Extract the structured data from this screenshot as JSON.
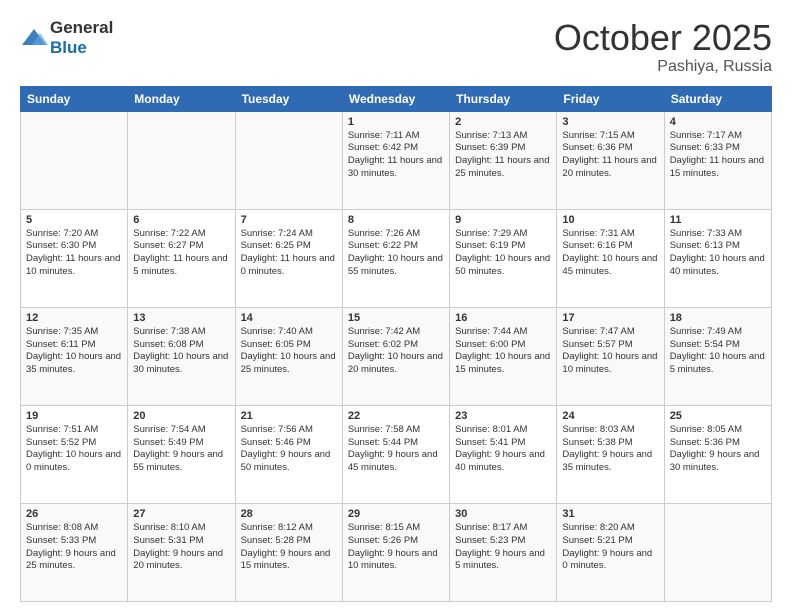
{
  "header": {
    "logo_general": "General",
    "logo_blue": "Blue",
    "month": "October 2025",
    "location": "Pashiya, Russia"
  },
  "weekdays": [
    "Sunday",
    "Monday",
    "Tuesday",
    "Wednesday",
    "Thursday",
    "Friday",
    "Saturday"
  ],
  "weeks": [
    [
      {
        "day": "",
        "info": ""
      },
      {
        "day": "",
        "info": ""
      },
      {
        "day": "",
        "info": ""
      },
      {
        "day": "1",
        "info": "Sunrise: 7:11 AM\nSunset: 6:42 PM\nDaylight: 11 hours\nand 30 minutes."
      },
      {
        "day": "2",
        "info": "Sunrise: 7:13 AM\nSunset: 6:39 PM\nDaylight: 11 hours\nand 25 minutes."
      },
      {
        "day": "3",
        "info": "Sunrise: 7:15 AM\nSunset: 6:36 PM\nDaylight: 11 hours\nand 20 minutes."
      },
      {
        "day": "4",
        "info": "Sunrise: 7:17 AM\nSunset: 6:33 PM\nDaylight: 11 hours\nand 15 minutes."
      }
    ],
    [
      {
        "day": "5",
        "info": "Sunrise: 7:20 AM\nSunset: 6:30 PM\nDaylight: 11 hours\nand 10 minutes."
      },
      {
        "day": "6",
        "info": "Sunrise: 7:22 AM\nSunset: 6:27 PM\nDaylight: 11 hours\nand 5 minutes."
      },
      {
        "day": "7",
        "info": "Sunrise: 7:24 AM\nSunset: 6:25 PM\nDaylight: 11 hours\nand 0 minutes."
      },
      {
        "day": "8",
        "info": "Sunrise: 7:26 AM\nSunset: 6:22 PM\nDaylight: 10 hours\nand 55 minutes."
      },
      {
        "day": "9",
        "info": "Sunrise: 7:29 AM\nSunset: 6:19 PM\nDaylight: 10 hours\nand 50 minutes."
      },
      {
        "day": "10",
        "info": "Sunrise: 7:31 AM\nSunset: 6:16 PM\nDaylight: 10 hours\nand 45 minutes."
      },
      {
        "day": "11",
        "info": "Sunrise: 7:33 AM\nSunset: 6:13 PM\nDaylight: 10 hours\nand 40 minutes."
      }
    ],
    [
      {
        "day": "12",
        "info": "Sunrise: 7:35 AM\nSunset: 6:11 PM\nDaylight: 10 hours\nand 35 minutes."
      },
      {
        "day": "13",
        "info": "Sunrise: 7:38 AM\nSunset: 6:08 PM\nDaylight: 10 hours\nand 30 minutes."
      },
      {
        "day": "14",
        "info": "Sunrise: 7:40 AM\nSunset: 6:05 PM\nDaylight: 10 hours\nand 25 minutes."
      },
      {
        "day": "15",
        "info": "Sunrise: 7:42 AM\nSunset: 6:02 PM\nDaylight: 10 hours\nand 20 minutes."
      },
      {
        "day": "16",
        "info": "Sunrise: 7:44 AM\nSunset: 6:00 PM\nDaylight: 10 hours\nand 15 minutes."
      },
      {
        "day": "17",
        "info": "Sunrise: 7:47 AM\nSunset: 5:57 PM\nDaylight: 10 hours\nand 10 minutes."
      },
      {
        "day": "18",
        "info": "Sunrise: 7:49 AM\nSunset: 5:54 PM\nDaylight: 10 hours\nand 5 minutes."
      }
    ],
    [
      {
        "day": "19",
        "info": "Sunrise: 7:51 AM\nSunset: 5:52 PM\nDaylight: 10 hours\nand 0 minutes."
      },
      {
        "day": "20",
        "info": "Sunrise: 7:54 AM\nSunset: 5:49 PM\nDaylight: 9 hours\nand 55 minutes."
      },
      {
        "day": "21",
        "info": "Sunrise: 7:56 AM\nSunset: 5:46 PM\nDaylight: 9 hours\nand 50 minutes."
      },
      {
        "day": "22",
        "info": "Sunrise: 7:58 AM\nSunset: 5:44 PM\nDaylight: 9 hours\nand 45 minutes."
      },
      {
        "day": "23",
        "info": "Sunrise: 8:01 AM\nSunset: 5:41 PM\nDaylight: 9 hours\nand 40 minutes."
      },
      {
        "day": "24",
        "info": "Sunrise: 8:03 AM\nSunset: 5:38 PM\nDaylight: 9 hours\nand 35 minutes."
      },
      {
        "day": "25",
        "info": "Sunrise: 8:05 AM\nSunset: 5:36 PM\nDaylight: 9 hours\nand 30 minutes."
      }
    ],
    [
      {
        "day": "26",
        "info": "Sunrise: 8:08 AM\nSunset: 5:33 PM\nDaylight: 9 hours\nand 25 minutes."
      },
      {
        "day": "27",
        "info": "Sunrise: 8:10 AM\nSunset: 5:31 PM\nDaylight: 9 hours\nand 20 minutes."
      },
      {
        "day": "28",
        "info": "Sunrise: 8:12 AM\nSunset: 5:28 PM\nDaylight: 9 hours\nand 15 minutes."
      },
      {
        "day": "29",
        "info": "Sunrise: 8:15 AM\nSunset: 5:26 PM\nDaylight: 9 hours\nand 10 minutes."
      },
      {
        "day": "30",
        "info": "Sunrise: 8:17 AM\nSunset: 5:23 PM\nDaylight: 9 hours\nand 5 minutes."
      },
      {
        "day": "31",
        "info": "Sunrise: 8:20 AM\nSunset: 5:21 PM\nDaylight: 9 hours\nand 0 minutes."
      },
      {
        "day": "",
        "info": ""
      }
    ]
  ]
}
